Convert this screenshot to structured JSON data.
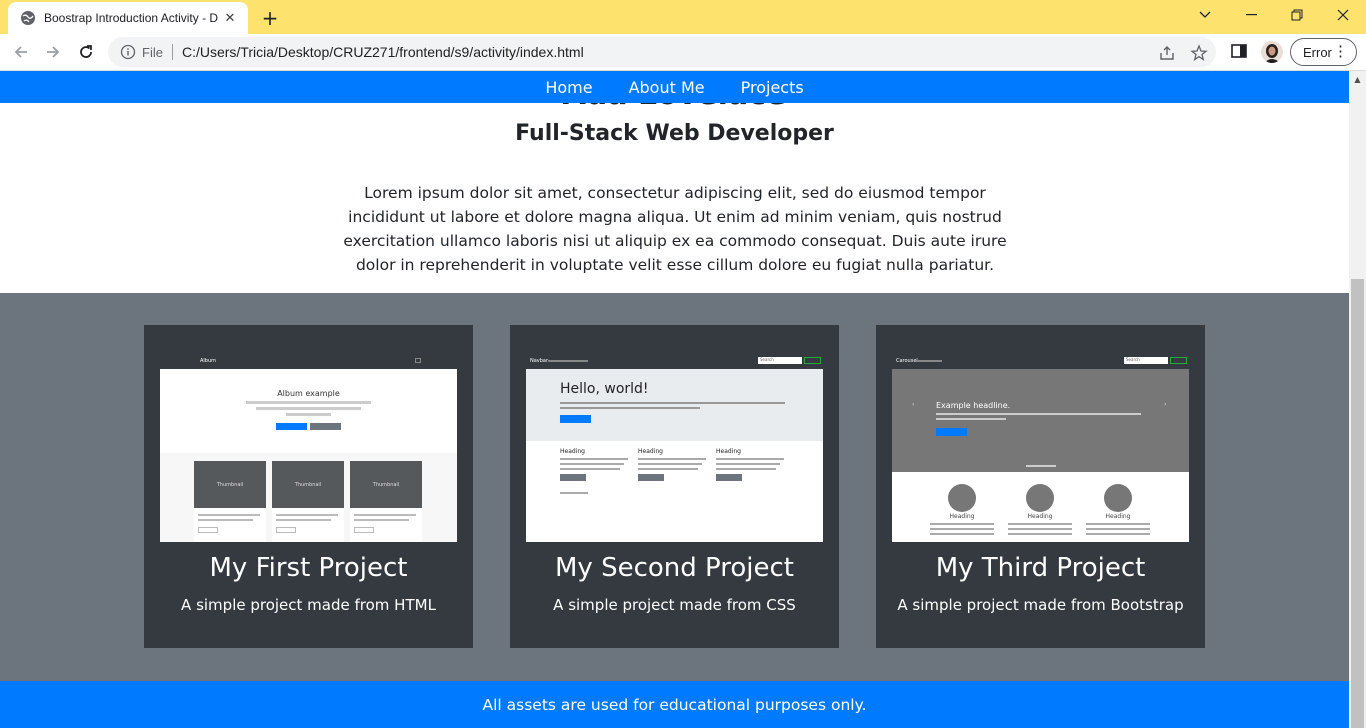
{
  "browser": {
    "tab_title": "Boostrap Introduction Activity - D",
    "omnibox_scheme": "File",
    "url": "C:/Users/Tricia/Desktop/CRUZ271/frontend/s9/activity/index.html",
    "profile_status": "Error"
  },
  "nav": {
    "items": [
      "Home",
      "About Me",
      "Projects"
    ]
  },
  "hero": {
    "name": "Ada Lovelace",
    "subtitle": "Full-Stack Web Developer",
    "paragraph": "Lorem ipsum dolor sit amet, consectetur adipiscing elit, sed do eiusmod tempor incididunt ut labore et dolore magna aliqua. Ut enim ad minim veniam, quis nostrud exercitation ullamco laboris nisi ut aliquip ex ea commodo consequat. Duis aute irure dolor in reprehenderit in voluptate velit esse cillum dolore eu fugiat nulla pariatur."
  },
  "projects": [
    {
      "title": "My First Project",
      "description": "A simple project made from HTML",
      "preview": {
        "brand": "Album",
        "heading": "Album example",
        "thumb_label": "Thumbnail"
      }
    },
    {
      "title": "My Second Project",
      "description": "A simple project made from CSS",
      "preview": {
        "brand": "Navbar",
        "heading": "Hello, world!",
        "col_heading": "Heading",
        "search": "Search"
      }
    },
    {
      "title": "My Third Project",
      "description": "A simple project made from Bootstrap",
      "preview": {
        "brand": "Carousel",
        "heading": "Example headline.",
        "col_heading": "Heading",
        "search": "Search"
      }
    }
  ],
  "footer": {
    "text": "All assets are used for educational purposes only."
  },
  "colors": {
    "primary": "#007bff",
    "dark": "#343a40",
    "secondary": "#6c757d",
    "tabstrip": "#fde36d"
  }
}
